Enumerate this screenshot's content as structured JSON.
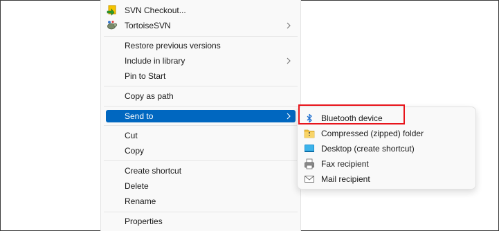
{
  "context_menu": {
    "items": [
      {
        "label": "SVN Checkout...",
        "icon": "svn-checkout-icon",
        "submenu": false
      },
      {
        "label": "TortoiseSVN",
        "icon": "tortoisesvn-icon",
        "submenu": true
      },
      {
        "label": "Restore previous versions",
        "submenu": false
      },
      {
        "label": "Include in library",
        "submenu": true
      },
      {
        "label": "Pin to Start",
        "submenu": false
      },
      {
        "label": "Copy as path",
        "submenu": false
      },
      {
        "label": "Send to",
        "submenu": true,
        "highlighted": true
      },
      {
        "label": "Cut",
        "submenu": false
      },
      {
        "label": "Copy",
        "submenu": false
      },
      {
        "label": "Create shortcut",
        "submenu": false
      },
      {
        "label": "Delete",
        "submenu": false
      },
      {
        "label": "Rename",
        "submenu": false
      },
      {
        "label": "Properties",
        "submenu": false
      }
    ]
  },
  "send_to_submenu": {
    "items": [
      {
        "label": "Bluetooth device",
        "icon": "bluetooth-icon",
        "outlined": true
      },
      {
        "label": "Compressed (zipped) folder",
        "icon": "zip-folder-icon"
      },
      {
        "label": "Desktop (create shortcut)",
        "icon": "desktop-icon"
      },
      {
        "label": "Fax recipient",
        "icon": "fax-icon"
      },
      {
        "label": "Mail recipient",
        "icon": "mail-icon"
      }
    ]
  },
  "colors": {
    "highlight": "#0067c0",
    "annotation_box": "#e8141b",
    "menu_background": "#f9f9f9"
  }
}
